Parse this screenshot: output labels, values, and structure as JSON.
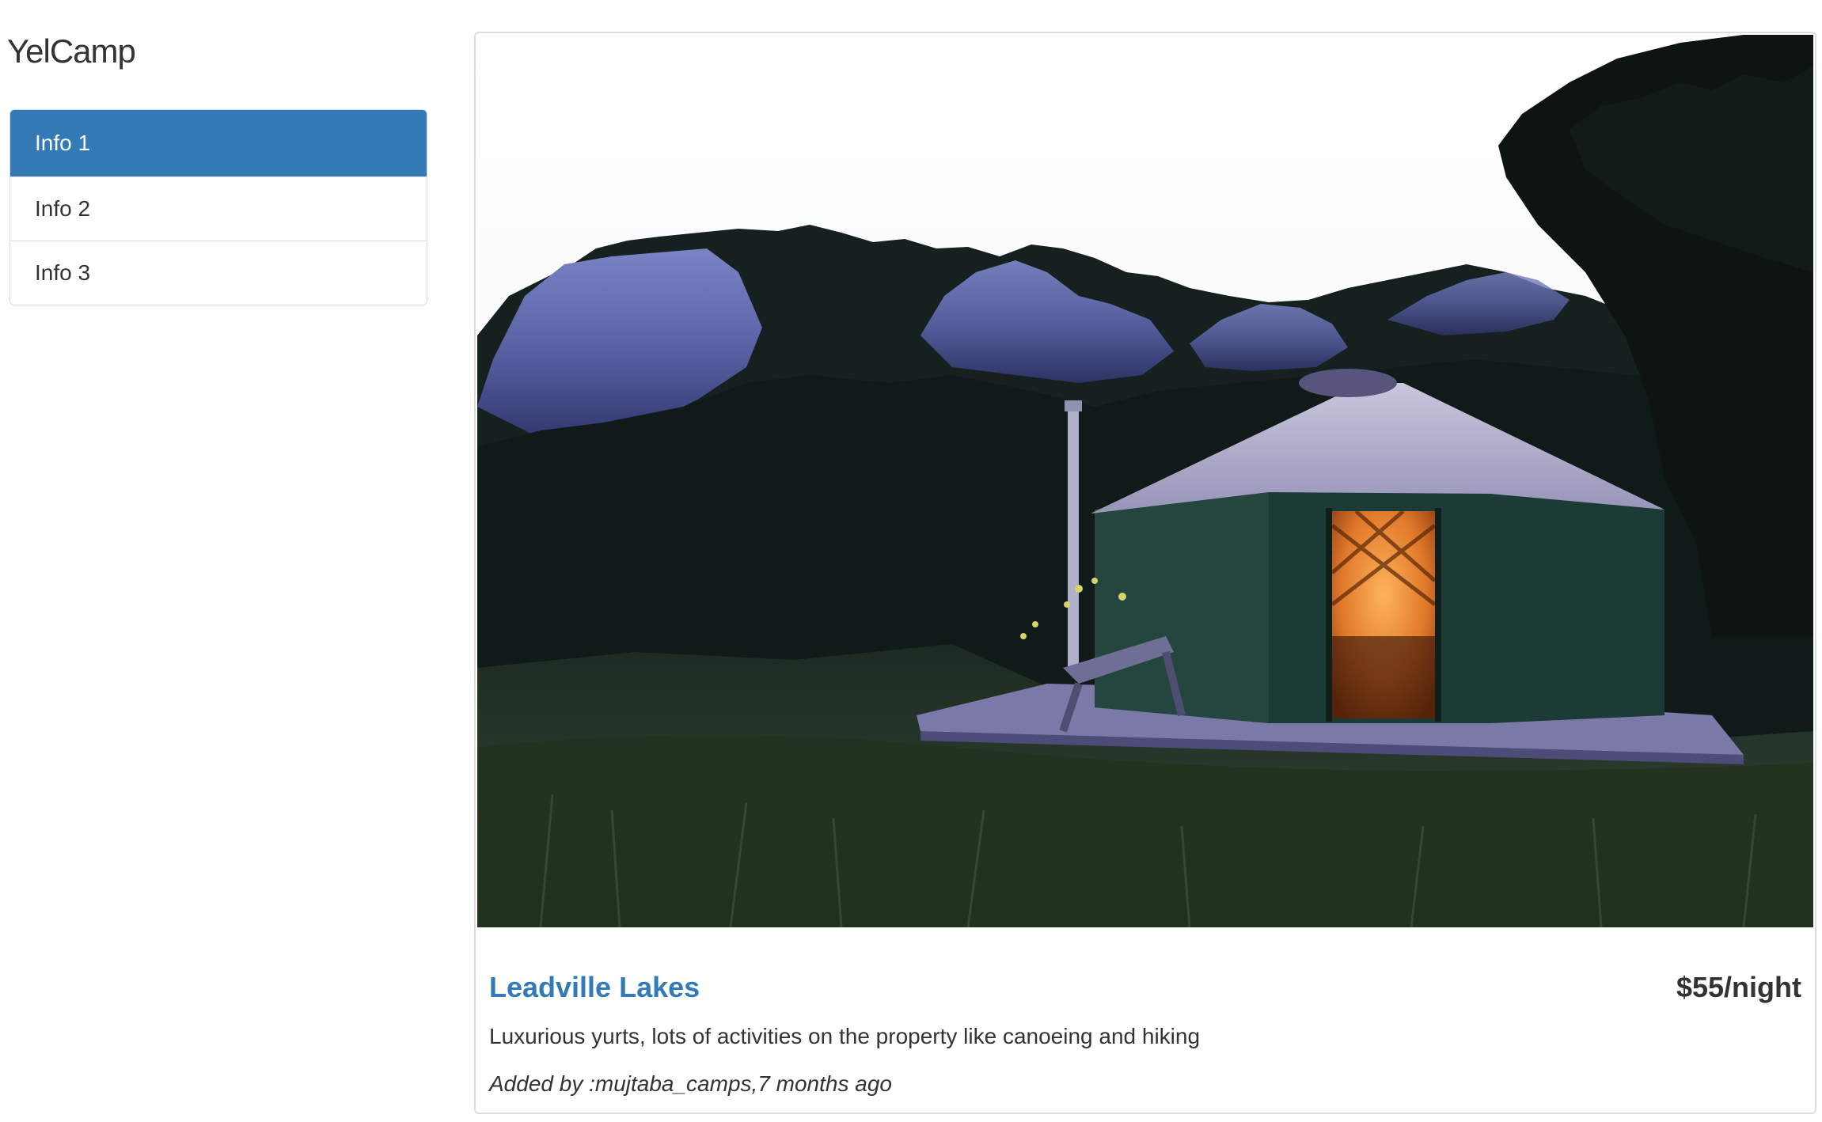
{
  "brand": "YelCamp",
  "sidebar": {
    "items": [
      {
        "label": "Info 1",
        "active": true
      },
      {
        "label": "Info 2",
        "active": false
      },
      {
        "label": "Info 3",
        "active": false
      }
    ]
  },
  "campground": {
    "name": "Leadville Lakes",
    "price": "$55/night",
    "description": "Luxurious yurts, lots of activities on the property like canoeing and hiking",
    "author_line": "Added by :mujtaba_camps,7 months ago",
    "image": "campground-photo"
  },
  "colors": {
    "accent": "#337ab7",
    "text": "#333333",
    "border": "#dddddd"
  }
}
